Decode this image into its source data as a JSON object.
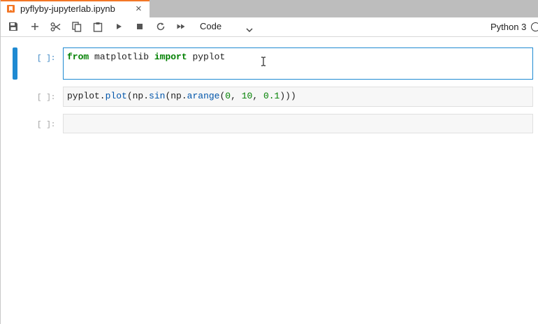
{
  "tab": {
    "title": "pyflyby-jupyterlab.ipynb",
    "close_glyph": "×",
    "icon": "notebook-icon"
  },
  "toolbar": {
    "buttons": [
      "save-icon",
      "plus-icon",
      "scissors-icon",
      "copy-icon",
      "paste-icon",
      "run-icon",
      "stop-icon",
      "restart-icon",
      "fast-forward-icon"
    ],
    "cell_type": "Code",
    "kernel_name": "Python 3"
  },
  "cells": [
    {
      "prompt": "[ ]:",
      "code_tokens": [
        {
          "t": "from",
          "c": "kw"
        },
        {
          "t": " matplotlib ",
          "c": ""
        },
        {
          "t": "import",
          "c": "kw"
        },
        {
          "t": " pyplot",
          "c": ""
        }
      ]
    },
    {
      "prompt": "[ ]:",
      "code_tokens": [
        {
          "t": "pyplot.",
          "c": ""
        },
        {
          "t": "plot",
          "c": "fn"
        },
        {
          "t": "(np.",
          "c": ""
        },
        {
          "t": "sin",
          "c": "fn"
        },
        {
          "t": "(np.",
          "c": ""
        },
        {
          "t": "arange",
          "c": "fn"
        },
        {
          "t": "(",
          "c": ""
        },
        {
          "t": "0",
          "c": "num"
        },
        {
          "t": ", ",
          "c": ""
        },
        {
          "t": "10",
          "c": "num"
        },
        {
          "t": ", ",
          "c": ""
        },
        {
          "t": "0.1",
          "c": "num"
        },
        {
          "t": ")))",
          "c": ""
        }
      ]
    },
    {
      "prompt": "[ ]:",
      "code_tokens": []
    }
  ],
  "colors": {
    "accent": "#1f8ad2",
    "tab_accent": "#f37726",
    "keyword": "#008000",
    "function": "#0055aa"
  }
}
